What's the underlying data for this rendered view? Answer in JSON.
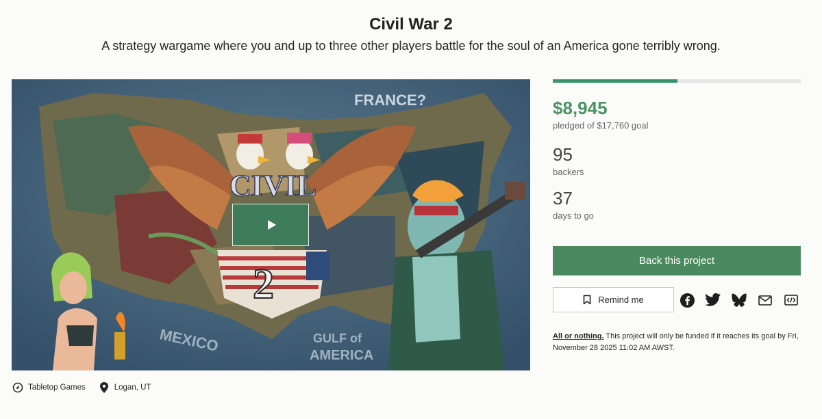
{
  "project": {
    "title": "Civil War 2",
    "blurb": "A strategy wargame where you and up to three other players battle for the soul of an America gone terribly wrong."
  },
  "hero": {
    "art_text": {
      "france": "FRANCE?",
      "mexico": "MEXICO",
      "gulf_line1": "GULF of",
      "gulf_line2": "AMERICA",
      "logo_word": "CIVIL",
      "logo_number": "2"
    }
  },
  "meta": {
    "category": "Tabletop Games",
    "location": "Logan, UT"
  },
  "funding": {
    "progress_fraction": 0.504,
    "pledged": "$8,945",
    "pledged_label": "pledged of $17,760 goal",
    "backers": "95",
    "backers_label": "backers",
    "days": "37",
    "days_label": "days to go"
  },
  "actions": {
    "back_label": "Back this project",
    "remind_label": "Remind me"
  },
  "share": [
    "facebook-icon",
    "twitter-icon",
    "bluesky-icon",
    "email-icon",
    "embed-icon"
  ],
  "notice": {
    "link": "All or nothing.",
    "text": " This project will only be funded if it reaches its goal by Fri, November 28 2025 11:02 AM AWST."
  },
  "colors": {
    "brand_green": "#4a8a5e",
    "pledged_green": "#4a9466",
    "progress_green": "#37946a"
  }
}
